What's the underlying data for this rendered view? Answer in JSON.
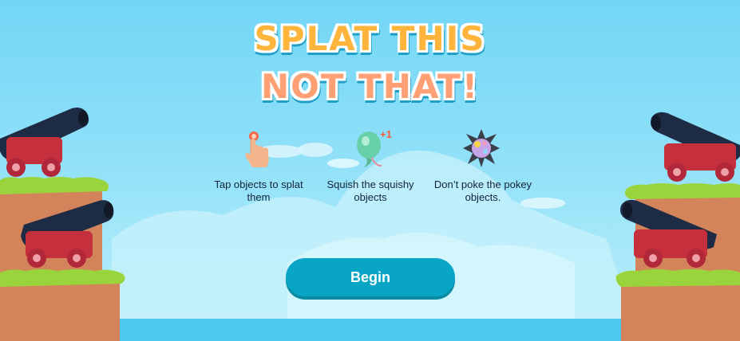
{
  "title": {
    "line1": "SPLAT THIS",
    "line2": "NOT THAT!"
  },
  "instructions": [
    {
      "icon": "tap-finger-icon",
      "text": "Tap objects to splat them"
    },
    {
      "icon": "squishy-balloon-icon",
      "badge": "+1",
      "text": "Squish the squishy objects"
    },
    {
      "icon": "spiky-ball-icon",
      "text": "Don’t poke the pokey objects."
    }
  ],
  "begin_button": {
    "label": "Begin"
  },
  "colors": {
    "sky": "#72d6f6",
    "title_orange": "#ffb43c",
    "title_salmon": "#ff9f74",
    "button": "#08a6c4",
    "grass": "#9ad43c",
    "cliff": "#d4845a",
    "cannon_barrel": "#1e2b44",
    "cannon_carriage": "#c6303c"
  }
}
